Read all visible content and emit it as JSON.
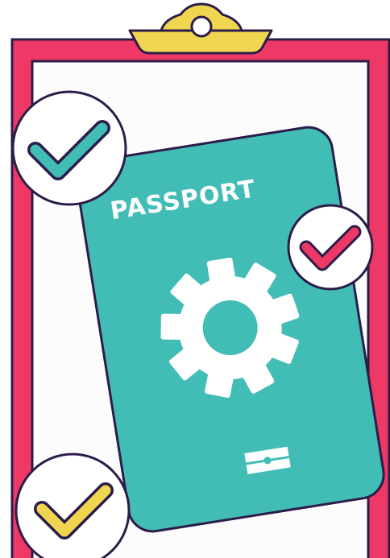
{
  "illustration": {
    "passport_label": "PASSPORT",
    "check_marks": [
      {
        "name": "check-top-left",
        "color": "#42bdb5"
      },
      {
        "name": "check-right",
        "color": "#ee3967"
      },
      {
        "name": "check-bottom-left",
        "color": "#f0d650"
      }
    ],
    "icons": [
      "clipboard-icon",
      "passport-icon",
      "gear-icon",
      "chip-icon",
      "checkmark-icon"
    ]
  },
  "colors": {
    "clipboard_frame": "#ee3967",
    "clipboard_clip": "#f0d650",
    "paper": "#fcfcfc",
    "passport": "#42bdb5",
    "outline": "#2c1c4a",
    "white": "#ffffff"
  }
}
